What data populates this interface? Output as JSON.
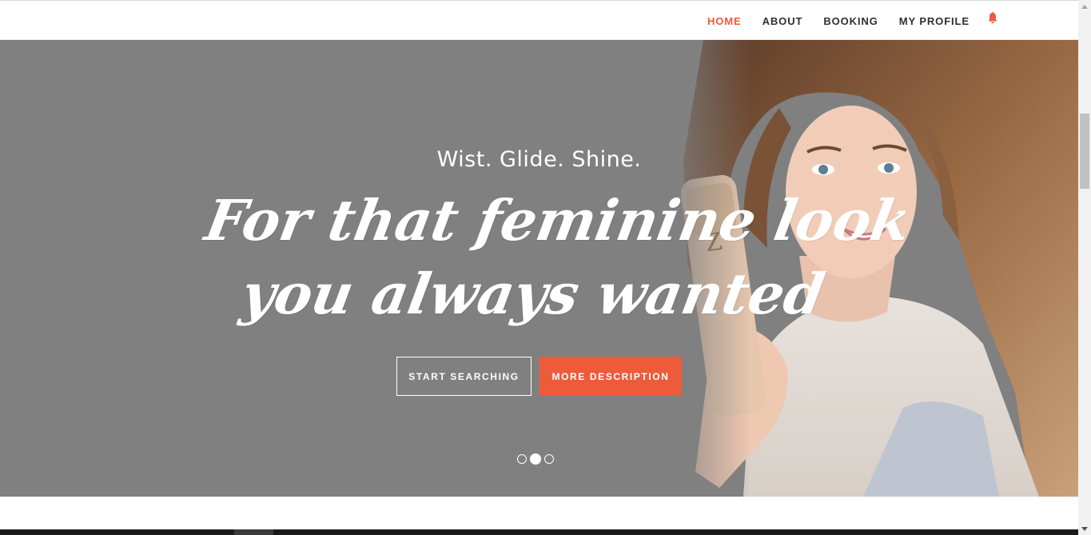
{
  "nav": {
    "items": [
      {
        "label": "HOME",
        "active": true
      },
      {
        "label": "ABOUT",
        "active": false
      },
      {
        "label": "BOOKING",
        "active": false
      },
      {
        "label": "MY PROFILE",
        "active": false
      }
    ],
    "notification_icon": "bell-icon",
    "accent_color": "#ee5b3a"
  },
  "hero": {
    "kicker": "Wist. Glide. Shine.",
    "heading_line1": "For that feminine look",
    "heading_line2": "you always wanted",
    "primary_button": "MORE DESCRIPTION",
    "secondary_button": "START SEARCHING",
    "carousel": {
      "slide_count": 3,
      "active_index": 1
    }
  }
}
